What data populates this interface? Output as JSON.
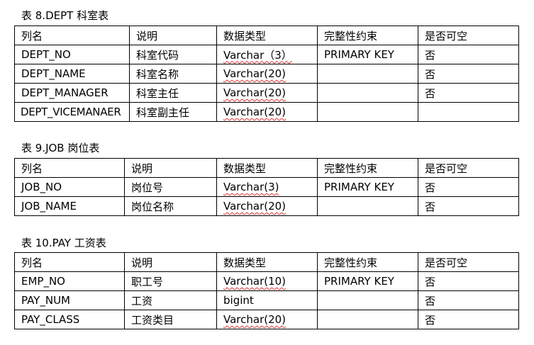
{
  "tables": [
    {
      "caption": "表 8.DEPT 科室表",
      "header": [
        "列名",
        "说明",
        "数据类型",
        "完整性约束",
        "是否可空"
      ],
      "rows": [
        [
          "DEPT_NO",
          "科室代码",
          "Varchar（3）",
          "PRIMARY KEY",
          "否"
        ],
        [
          "DEPT_NAME",
          "科室名称",
          "Varchar(20)",
          "",
          "否"
        ],
        [
          "DEPT_MANAGER",
          "科室主任",
          "Varchar(20)",
          "",
          "否"
        ],
        [
          "DEPT_VICEMANAER",
          "科室副主任",
          "Varchar(20)",
          "",
          ""
        ]
      ]
    },
    {
      "caption": "表 9.JOB 岗位表",
      "header": [
        "列名",
        "说明",
        "数据类型",
        "完整性约束",
        "是否可空"
      ],
      "rows": [
        [
          "JOB_NO",
          "岗位号",
          "Varchar(3)",
          "PRIMARY KEY",
          "否"
        ],
        [
          "JOB_NAME",
          "岗位名称",
          "Varchar(20)",
          "",
          "否"
        ]
      ]
    },
    {
      "caption": "表 10.PAY 工资表",
      "header": [
        "列名",
        "说明",
        "数据类型",
        "完整性约束",
        "是否可空"
      ],
      "rows": [
        [
          "EMP_NO",
          "职工号",
          "Varchar(10)",
          "PRIMARY KEY",
          "否"
        ],
        [
          "PAY_NUM",
          "工资",
          "bigint",
          "",
          "否"
        ],
        [
          "PAY_CLASS",
          "工资类目",
          "Varchar(20)",
          "",
          "否"
        ]
      ]
    }
  ]
}
